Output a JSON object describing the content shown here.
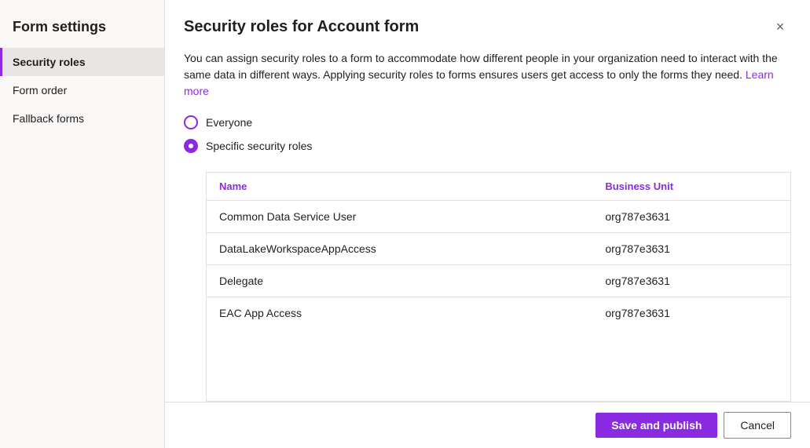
{
  "sidebar": {
    "title": "Form settings",
    "items": [
      {
        "id": "security-roles",
        "label": "Security roles",
        "active": true
      },
      {
        "id": "form-order",
        "label": "Form order",
        "active": false
      },
      {
        "id": "fallback-forms",
        "label": "Fallback forms",
        "active": false
      }
    ]
  },
  "dialog": {
    "title": "Security roles for Account form",
    "close_label": "×",
    "description_text": "You can assign security roles to a form to accommodate how different people in your organization need to interact with the same data in different ways. Applying security roles to forms ensures users get access to only the forms they need.",
    "learn_more_label": "Learn more",
    "learn_more_url": "#"
  },
  "radio_options": [
    {
      "id": "everyone",
      "label": "Everyone",
      "checked": false
    },
    {
      "id": "specific",
      "label": "Specific security roles",
      "checked": true
    }
  ],
  "table": {
    "columns": [
      {
        "id": "name",
        "label": "Name"
      },
      {
        "id": "business_unit",
        "label": "Business Unit"
      }
    ],
    "rows": [
      {
        "name": "Common Data Service User",
        "business_unit": "org787e3631"
      },
      {
        "name": "DataLakeWorkspaceAppAccess",
        "business_unit": "org787e3631"
      },
      {
        "name": "Delegate",
        "business_unit": "org787e3631"
      },
      {
        "name": "EAC App Access",
        "business_unit": "org787e3631"
      }
    ]
  },
  "footer": {
    "save_label": "Save and publish",
    "cancel_label": "Cancel"
  }
}
